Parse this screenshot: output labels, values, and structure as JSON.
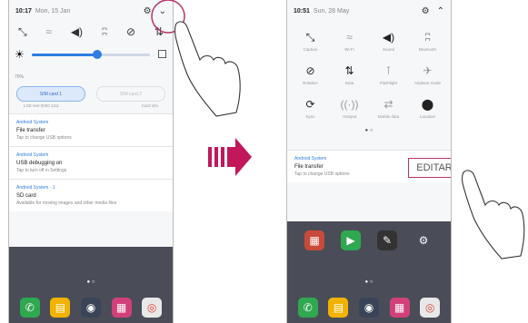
{
  "colors": {
    "accent": "#2f7de1",
    "highlight": "#b8336a"
  },
  "left": {
    "status": {
      "time": "10:17",
      "date": "Mon, 15 Jan"
    },
    "icons": [
      "screen-rotate-icon",
      "wifi-icon",
      "sound-icon",
      "bluetooth-icon",
      "do-not-disturb-icon",
      "data-icon"
    ],
    "brightness": {
      "value": 0.55,
      "auto_label": "70%"
    },
    "sims": {
      "sim1": "SIM card 1",
      "sim2": "SIM card 2",
      "sim1_sub": "LGE test 0000 1111",
      "sim2_sub": "Card info"
    },
    "notifications": [
      {
        "app": "Android System",
        "title": "File transfer",
        "text": "Tap to change USB options"
      },
      {
        "app": "Android System",
        "title": "USB debugging on",
        "text": "Tap to turn off in Settings"
      },
      {
        "app": "Android System · 1",
        "title": "SD card",
        "text": "Available for moving images and other media files"
      }
    ]
  },
  "right": {
    "status": {
      "time": "10:51",
      "date": "Sun, 28 May"
    },
    "tiles": [
      {
        "icon": "screen-rotate-icon",
        "glyph": "⤡",
        "label": "Capture"
      },
      {
        "icon": "wifi-icon",
        "glyph": "≈",
        "label": "Wi-Fi",
        "dim": true
      },
      {
        "icon": "sound-icon",
        "glyph": "◀)",
        "label": "Sound"
      },
      {
        "icon": "bluetooth-icon",
        "glyph": "ʭ",
        "label": "Bluetooth",
        "dim": true
      },
      {
        "icon": "do-not-disturb-icon",
        "glyph": "⊘",
        "label": "Rotation"
      },
      {
        "icon": "data-icon",
        "glyph": "⇅",
        "label": "Data"
      },
      {
        "icon": "flashlight-icon",
        "glyph": "⊺",
        "label": "Flashlight",
        "dim": true
      },
      {
        "icon": "airplane-icon",
        "glyph": "✈",
        "label": "Airplane mode",
        "dim": true
      },
      {
        "icon": "sync-icon",
        "glyph": "⟳",
        "label": "Sync"
      },
      {
        "icon": "nfc-icon",
        "glyph": "((·))",
        "label": "Hotspot",
        "dim": true
      },
      {
        "icon": "mobile-data-icon",
        "glyph": "⇄",
        "label": "Mobile data",
        "dim": true
      },
      {
        "icon": "location-icon",
        "glyph": "⬤",
        "label": "Location"
      }
    ],
    "edit_label": "EDITAR",
    "notification": {
      "app": "Android System",
      "title": "File transfer",
      "text": "Tap to change USB options"
    }
  }
}
